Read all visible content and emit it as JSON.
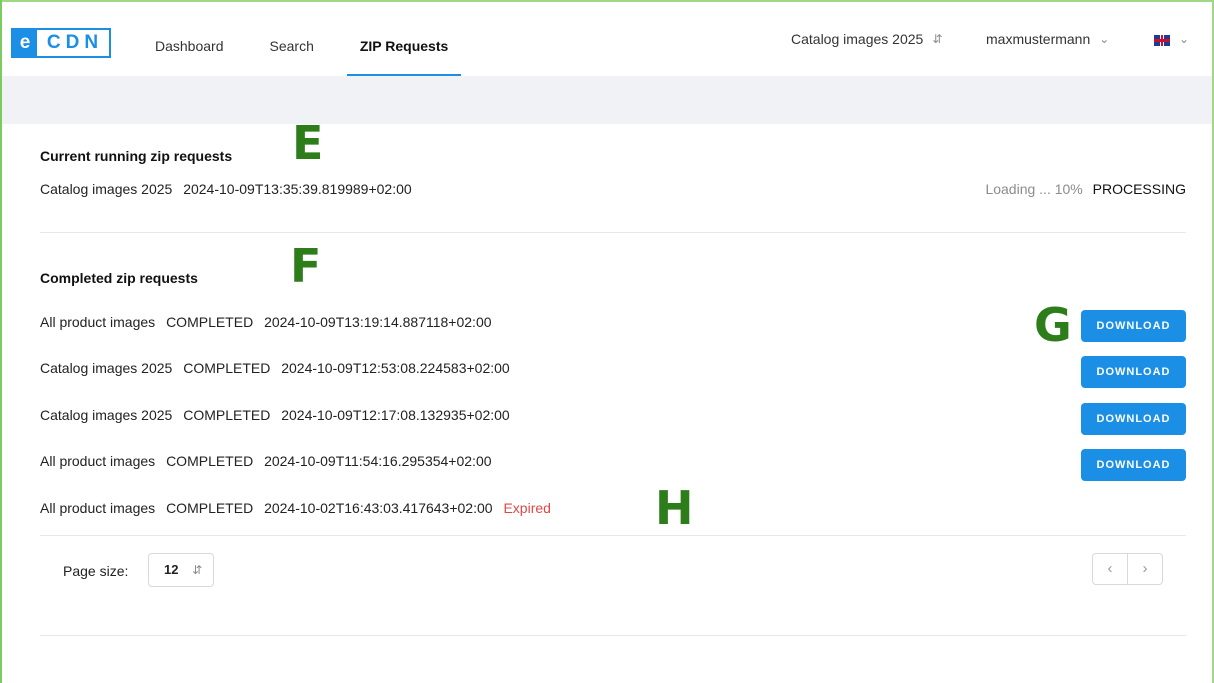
{
  "brand": {
    "logo_e": "e",
    "logo_cdn": "CDN",
    "accent": "#1b8fe6"
  },
  "nav": {
    "items": [
      {
        "label": "Dashboard"
      },
      {
        "label": "Search"
      },
      {
        "label": "ZIP Requests",
        "active": true
      }
    ]
  },
  "header": {
    "catalog_label": "Catalog images 2025",
    "user_label": "maxmustermann",
    "language_icon": "uk-flag-icon"
  },
  "running": {
    "title": "Current running zip requests",
    "items": [
      {
        "catalog": "Catalog images 2025",
        "timestamp": "2024-10-09T13:35:39.819989+02:00",
        "progress_text": "Loading ... 10%",
        "status": "PROCESSING"
      }
    ]
  },
  "completed": {
    "title": "Completed zip requests",
    "download_label": "DOWNLOAD",
    "expired_label": "Expired",
    "items": [
      {
        "catalog": "All product images",
        "status": "COMPLETED",
        "timestamp": "2024-10-09T13:19:14.887118+02:00"
      },
      {
        "catalog": "Catalog images 2025",
        "status": "COMPLETED",
        "timestamp": "2024-10-09T12:53:08.224583+02:00"
      },
      {
        "catalog": "Catalog images 2025",
        "status": "COMPLETED",
        "timestamp": "2024-10-09T12:17:08.132935+02:00"
      },
      {
        "catalog": "All product images",
        "status": "COMPLETED",
        "timestamp": "2024-10-09T11:54:16.295354+02:00"
      },
      {
        "catalog": "All product images",
        "status": "COMPLETED",
        "timestamp": "2024-10-02T16:43:03.417643+02:00",
        "expired": true
      }
    ]
  },
  "pagination": {
    "page_size_label": "Page size:",
    "page_size_value": "12",
    "prev_icon": "chevron-left-icon",
    "next_icon": "chevron-right-icon"
  },
  "annotations": {
    "e": "E",
    "f": "F",
    "g": "G",
    "h": "H",
    "color": "#2e7d1b"
  }
}
